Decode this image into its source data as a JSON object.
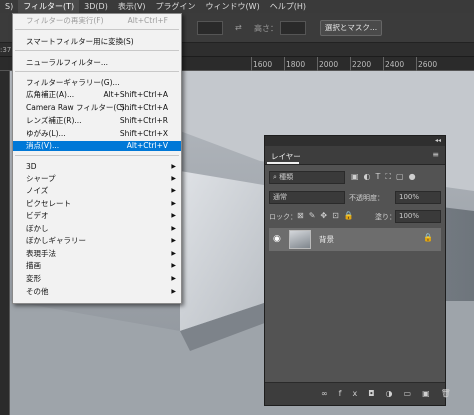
{
  "menubar": {
    "items": [
      "S)",
      "フィルター(T)",
      "3D(D)",
      "表示(V)",
      "プラグイン",
      "ウィンドウ(W)",
      "ヘルプ(H)"
    ]
  },
  "options_bar": {
    "height_label": "高さ：",
    "select_mask_button": "選択とマスク..."
  },
  "doc_tab": {
    "label_fragment": ":37"
  },
  "ruler": {
    "ticks": [
      "1600",
      "1800",
      "2000",
      "2200",
      "2400",
      "2600"
    ]
  },
  "filter_menu": {
    "items": [
      {
        "label": "フィルターの再実行(F)",
        "shortcut": "Alt+Ctrl+F",
        "disabled": true
      },
      {
        "label": "スマートフィルター用に変換(S)",
        "shortcut": ""
      },
      {
        "label": "ニューラルフィルター...",
        "shortcut": ""
      },
      {
        "label": "フィルターギャラリー(G)...",
        "shortcut": ""
      },
      {
        "label": "広角補正(A)...",
        "shortcut": "Alt+Shift+Ctrl+A"
      },
      {
        "label": "Camera Raw フィルター(C)...",
        "shortcut": "Shift+Ctrl+A"
      },
      {
        "label": "レンズ補正(R)...",
        "shortcut": "Shift+Ctrl+R"
      },
      {
        "label": "ゆがみ(L)...",
        "shortcut": "Shift+Ctrl+X"
      },
      {
        "label": "消点(V)...",
        "shortcut": "Alt+Ctrl+V",
        "selected": true
      },
      {
        "label": "3D",
        "submenu": true
      },
      {
        "label": "シャープ",
        "submenu": true
      },
      {
        "label": "ノイズ",
        "submenu": true
      },
      {
        "label": "ピクセレート",
        "submenu": true
      },
      {
        "label": "ビデオ",
        "submenu": true
      },
      {
        "label": "ぼかし",
        "submenu": true
      },
      {
        "label": "ぼかしギャラリー",
        "submenu": true
      },
      {
        "label": "表現手法",
        "submenu": true
      },
      {
        "label": "描画",
        "submenu": true
      },
      {
        "label": "変形",
        "submenu": true
      },
      {
        "label": "その他",
        "submenu": true
      }
    ]
  },
  "layers_panel": {
    "collapse_glyph": "◂◂",
    "tab_label": "レイヤー",
    "menu_icon": "≡",
    "kind_label": "種類",
    "blend_mode": "通常",
    "opacity_label": "不透明度：",
    "opacity_value": "100%",
    "lock_label": "ロック：",
    "fill_label": "塗り：",
    "fill_value": "100%",
    "layer_name": "背景"
  },
  "icons": {
    "eye": "visibility-eye-icon",
    "lock": "lock-icon",
    "menu": "panel-menu-icon"
  }
}
